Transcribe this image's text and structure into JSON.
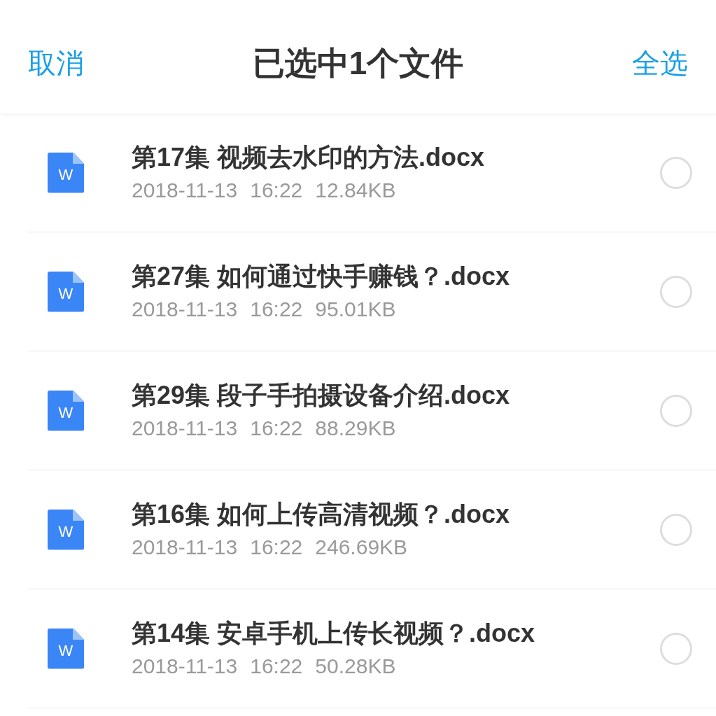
{
  "header": {
    "cancel": "取消",
    "title": "已选中1个文件",
    "select_all": "全选"
  },
  "files": [
    {
      "badge": "W",
      "name": "第17集 视频去水印的方法.docx",
      "date": "2018-11-13",
      "time": "16:22",
      "size": "12.84KB",
      "selected": false
    },
    {
      "badge": "W",
      "name": "第27集 如何通过快手赚钱？.docx",
      "date": "2018-11-13",
      "time": "16:22",
      "size": "95.01KB",
      "selected": false
    },
    {
      "badge": "W",
      "name": "第29集 段子手拍摄设备介绍.docx",
      "date": "2018-11-13",
      "time": "16:22",
      "size": "88.29KB",
      "selected": false
    },
    {
      "badge": "W",
      "name": "第16集 如何上传高清视频？.docx",
      "date": "2018-11-13",
      "time": "16:22",
      "size": "246.69KB",
      "selected": false
    },
    {
      "badge": "W",
      "name": "第14集 安卓手机上传长视频？.docx",
      "date": "2018-11-13",
      "time": "16:22",
      "size": "50.28KB",
      "selected": false
    }
  ]
}
